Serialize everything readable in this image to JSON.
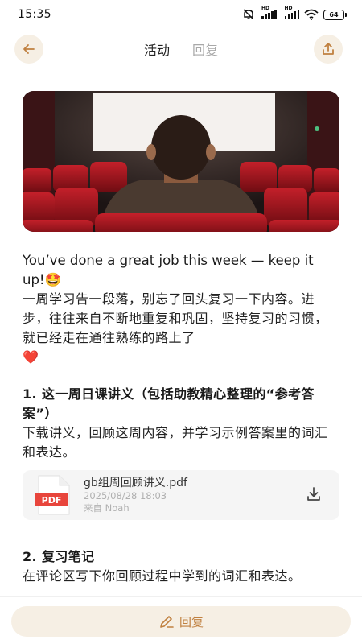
{
  "status": {
    "time": "15:35",
    "battery": "64"
  },
  "nav": {
    "tab_active": "活动",
    "tab_reply": "回复"
  },
  "post": {
    "headline": "You’ve done a great job this week — keep it up!",
    "headline_emoji": "🤩",
    "intro": "一周学习告一段落，别忘了回头复习一下内容。进步，往往来自不断地重复和巩固，坚持复习的习惯，就已经走在通往熟练的路上了",
    "intro_emoji": "❤️",
    "section1_title": "1. 这一周日课讲义（包括助教精心整理的“参考答案”）",
    "section1_text": "下载讲义，回顾这周内容，并学习示例答案里的词汇和表达。",
    "file": {
      "icon_label": "PDF",
      "name": "gb组周回顾讲义.pdf",
      "date": "2025/08/28 18:03",
      "from": "来自 Noah"
    },
    "section2_title": "2. 复习笔记",
    "section2_text": "在评论区写下你回顾过程中学到的词汇和表达。"
  },
  "footer": {
    "reply_label": "回复"
  },
  "colors": {
    "accent": "#c08040",
    "pill_bg": "#f6efe4",
    "pdf_red": "#e8453c"
  }
}
